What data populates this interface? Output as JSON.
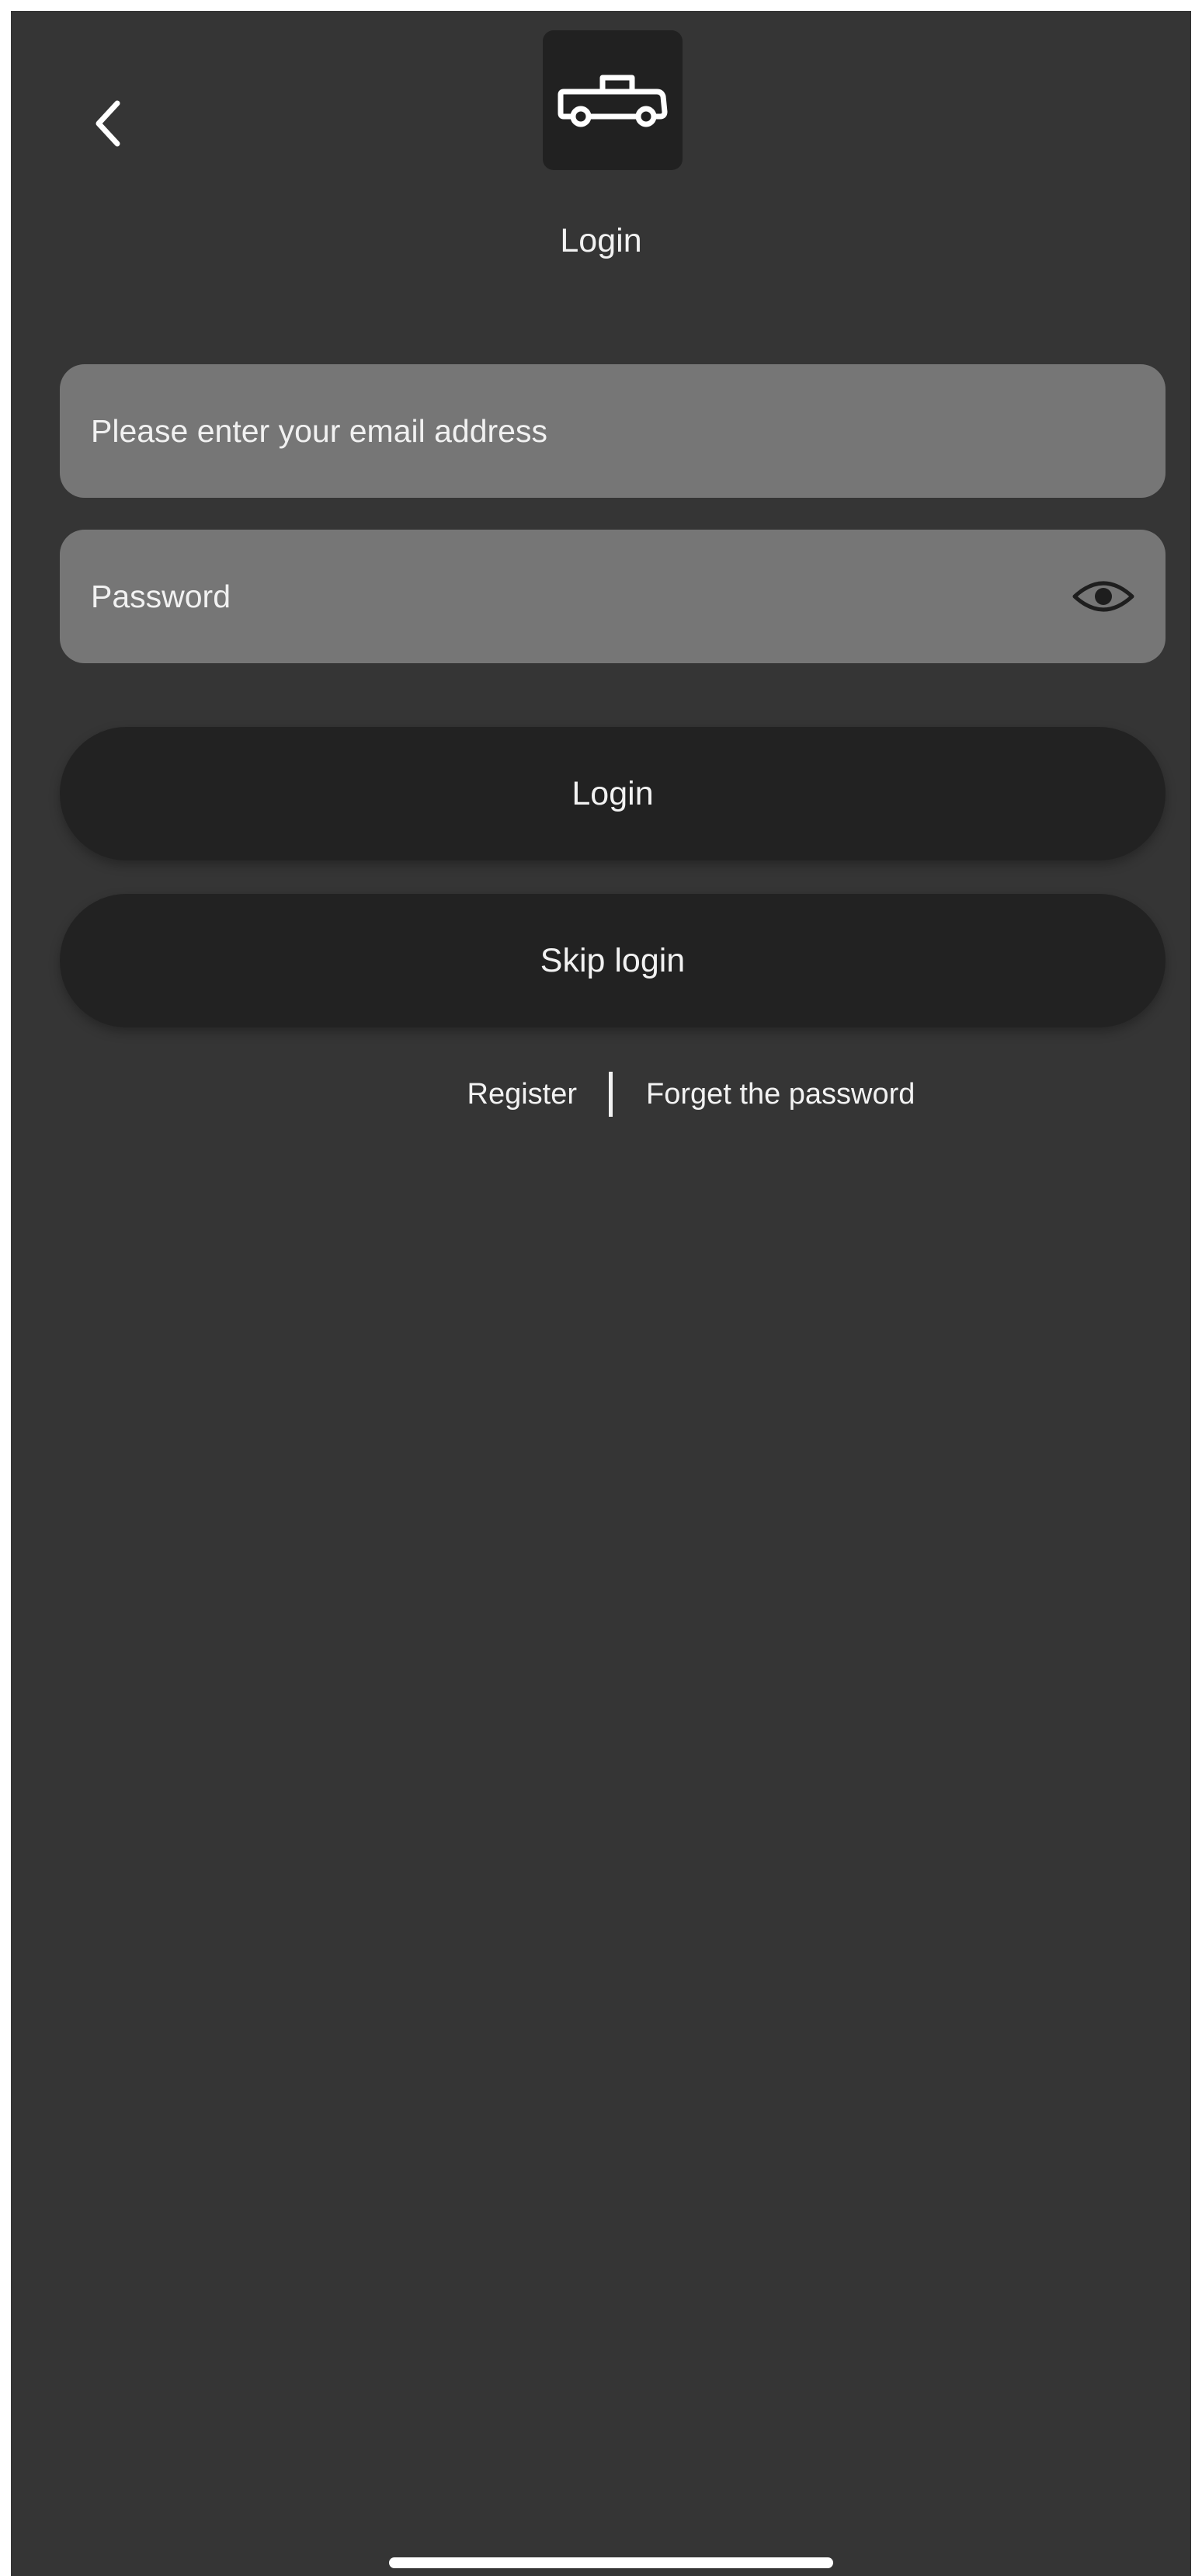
{
  "header": {
    "back_icon": "chevron-left-icon",
    "logo_icon": "pickup-truck-icon",
    "title": "Login"
  },
  "form": {
    "email": {
      "placeholder": "Please enter your email address",
      "value": ""
    },
    "password": {
      "placeholder": "Password",
      "value": "",
      "toggle_icon": "eye-icon"
    }
  },
  "actions": {
    "login_label": "Login",
    "skip_label": "Skip login"
  },
  "links": {
    "register": "Register",
    "forgot_password": "Forget the password"
  },
  "colors": {
    "background": "#353535",
    "field": "#767676",
    "button": "#222222",
    "text": "#f2f2f2"
  }
}
